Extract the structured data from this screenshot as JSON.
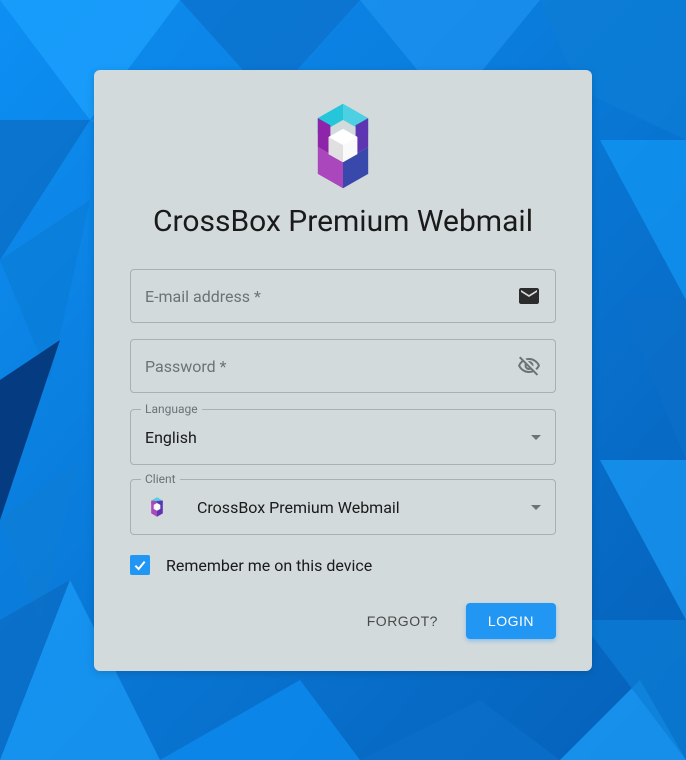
{
  "title": "CrossBox Premium Webmail",
  "fields": {
    "email": {
      "label": "E-mail address *"
    },
    "password": {
      "label": "Password *"
    },
    "language": {
      "legend": "Language",
      "value": "English"
    },
    "client": {
      "legend": "Client",
      "value": "CrossBox Premium Webmail"
    }
  },
  "remember": {
    "label": "Remember me on this device",
    "checked": true
  },
  "actions": {
    "forgot": "Forgot?",
    "login": "Login"
  }
}
